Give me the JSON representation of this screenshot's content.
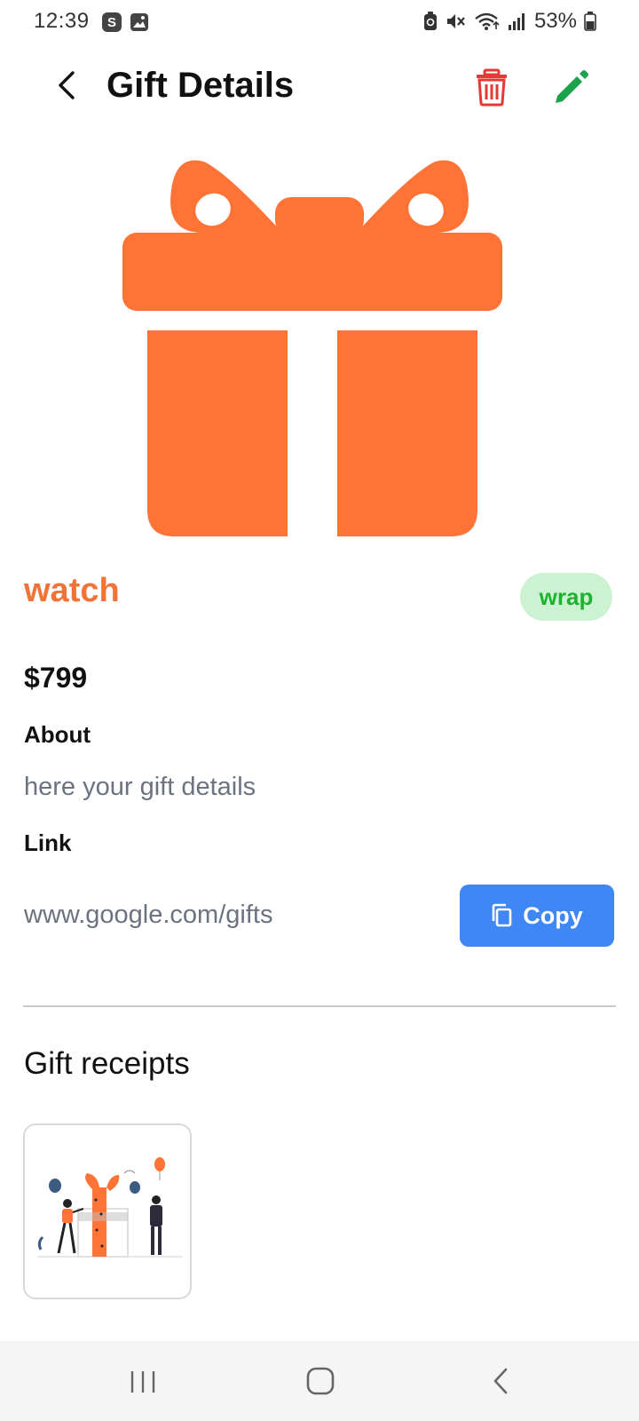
{
  "status_bar": {
    "time": "12:39",
    "app_badge": "S",
    "battery": "53%"
  },
  "header": {
    "title": "Gift Details"
  },
  "gift": {
    "name": "watch",
    "tag": "wrap",
    "price": "$799",
    "about_heading": "About",
    "about_text": "here your gift details",
    "link_heading": "Link",
    "link_text": "www.google.com/gifts",
    "copy_label": "Copy"
  },
  "receipts": {
    "heading": "Gift receipts"
  },
  "colors": {
    "accent_orange": "#f07438",
    "gift_orange": "#ff7337",
    "delete_red": "#e53935",
    "edit_green": "#1aa34a",
    "copy_blue": "#3f87f5",
    "tag_bg": "#ccf2d2",
    "tag_text": "#1db330"
  },
  "icons": {
    "back": "back-arrow-icon",
    "delete": "trash-icon",
    "edit": "pencil-icon",
    "copy": "copy-icon",
    "gift": "gift-icon"
  }
}
